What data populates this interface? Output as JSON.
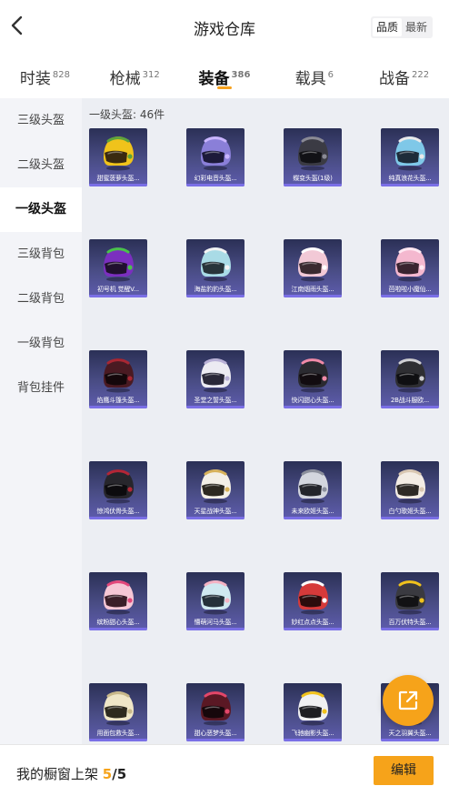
{
  "header": {
    "title": "游戏仓库",
    "sort_options": [
      "品质",
      "最新"
    ],
    "sort_active": 0
  },
  "tabs": [
    {
      "label": "时装",
      "count": "828",
      "active": false
    },
    {
      "label": "枪械",
      "count": "312",
      "active": false
    },
    {
      "label": "装备",
      "count": "386",
      "active": true
    },
    {
      "label": "载具",
      "count": "6",
      "active": false
    },
    {
      "label": "战备",
      "count": "222",
      "active": false
    }
  ],
  "sidebar": [
    {
      "label": "三级头盔",
      "active": false
    },
    {
      "label": "二级头盔",
      "active": false
    },
    {
      "label": "一级头盔",
      "active": true
    },
    {
      "label": "三级背包",
      "active": false
    },
    {
      "label": "二级背包",
      "active": false
    },
    {
      "label": "一级背包",
      "active": false
    },
    {
      "label": "背包挂件",
      "active": false
    }
  ],
  "section_title": "一级头盔: 46件",
  "items": [
    {
      "name": "甜蜜菠萝头盔...",
      "color": "#f0c31b",
      "accent": "#5ea33c",
      "visor": "#3a2a10"
    },
    {
      "name": "幻彩电音头盔...",
      "color": "#8a7fd8",
      "accent": "#c9b5ff",
      "visor": "#1d1a3a"
    },
    {
      "name": "蝶变头盔(1级)",
      "color": "#3b3b44",
      "accent": "#8a8a95",
      "visor": "#121216"
    },
    {
      "name": "纯真浪花头盔...",
      "color": "#7fc8e8",
      "accent": "#e9e9ea",
      "visor": "#1e2c3a"
    },
    {
      "name": "初号机 觉醒V...",
      "color": "#7b2fbf",
      "accent": "#49c24a",
      "visor": "#20102e"
    },
    {
      "name": "海盐豹豹头盔...",
      "color": "#a9dbe6",
      "accent": "#f2f2f2",
      "visor": "#28343a"
    },
    {
      "name": "江南烟雨头盔...",
      "color": "#f2c9d6",
      "accent": "#ffffff",
      "visor": "#3a2a30"
    },
    {
      "name": "芭啦啦小魔仙...",
      "color": "#f4b8cf",
      "accent": "#ffe8f2",
      "visor": "#3a2430"
    },
    {
      "name": "焰鹰斗篷头盔...",
      "color": "#4a1a22",
      "accent": "#a82733",
      "visor": "#14070a"
    },
    {
      "name": "圣堂之誓头盔...",
      "color": "#ecebf2",
      "accent": "#b8b0d6",
      "visor": "#2a2838"
    },
    {
      "name": "快闪甜心头盔...",
      "color": "#2a2a30",
      "accent": "#f08aa8",
      "visor": "#120c10"
    },
    {
      "name": "2B战斗服欧...",
      "color": "#2e2e32",
      "accent": "#cfcfd3",
      "visor": "#0f0f12"
    },
    {
      "name": "惊鸿伏骨头盔...",
      "color": "#27262c",
      "accent": "#b32636",
      "visor": "#0c0b0e"
    },
    {
      "name": "天星战神头盔...",
      "color": "#f3efe6",
      "accent": "#d7b15a",
      "visor": "#2c2820"
    },
    {
      "name": "未来欧姬头盔...",
      "color": "#d3d6de",
      "accent": "#8b8f9c",
      "visor": "#23252b"
    },
    {
      "name": "白勺歌姬头盔...",
      "color": "#f3ece4",
      "accent": "#d9c7b2",
      "visor": "#2e2a26"
    },
    {
      "name": "缤粉甜心头盔...",
      "color": "#f6c7d5",
      "accent": "#e3477a",
      "visor": "#3a1e28"
    },
    {
      "name": "懵萌河马头盔...",
      "color": "#cfe8f0",
      "accent": "#f4b2c3",
      "visor": "#24303a"
    },
    {
      "name": "妙红点点头盔...",
      "color": "#d63a3a",
      "accent": "#ffffff",
      "visor": "#2c0c0c"
    },
    {
      "name": "百万伏特头盔...",
      "color": "#3a3a40",
      "accent": "#f0c21c",
      "visor": "#121214"
    },
    {
      "name": "用面包救头盔...",
      "color": "#efe6c7",
      "accent": "#c8b88a",
      "visor": "#2e2a1e"
    },
    {
      "name": "甜心恶梦头盔...",
      "color": "#5a1824",
      "accent": "#e3476a",
      "visor": "#16070b"
    },
    {
      "name": "飞驰幽影头盔...",
      "color": "#f0f0f2",
      "accent": "#f2c21c",
      "visor": "#1e1e22"
    },
    {
      "name": "天之羽翼头盔...",
      "color": "#e9e3f4",
      "accent": "#b9a8e6",
      "visor": "#2a2634"
    }
  ],
  "footer": {
    "label": "我的橱窗上架",
    "count": "5",
    "separator": "/",
    "total": "5",
    "edit_label": "编辑"
  },
  "colors": {
    "accent": "#f6a31a",
    "card_bg_top": "#2b3056",
    "card_bg_bottom": "#5e5cae"
  },
  "icons": {
    "back": "chevron-left-icon",
    "fab": "share-external-icon"
  }
}
